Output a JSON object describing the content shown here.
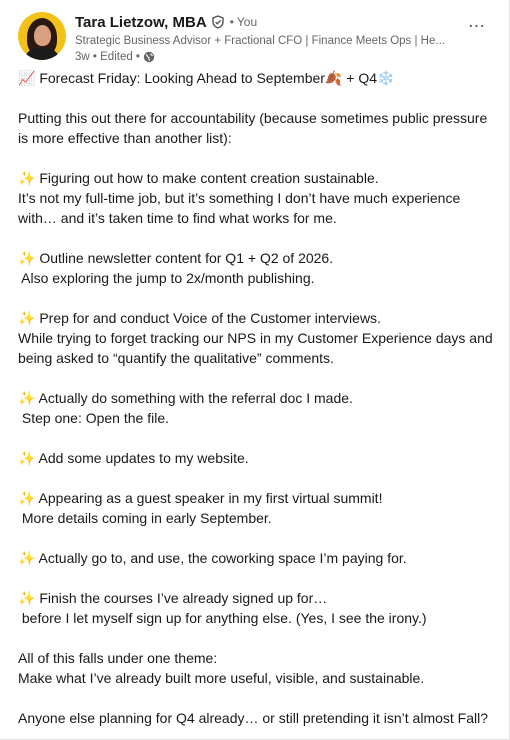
{
  "author": {
    "name": "Tara Lietzow, MBA",
    "you_label": "You",
    "headline": "Strategic Business Advisor + Fractional CFO | Finance Meets Ops | He...",
    "time": "3w",
    "edited_label": "Edited",
    "visibility_icon": "globe-icon",
    "verified_icon": "verified-shield-icon"
  },
  "menu": {
    "more_label": "…"
  },
  "post": {
    "lines": [
      "📈 Forecast Friday: Looking Ahead to September🍂 + Q4❄️",
      "",
      "Putting this out there for accountability (because sometimes public pressure",
      "is more effective than another list):",
      "",
      "✨ Figuring out how to make content creation sustainable.",
      "It’s not my full-time job, but it’s something I don’t have much experience",
      "with… and it’s taken time to find what works for me.",
      "",
      "✨ Outline newsletter content for Q1 + Q2 of 2026.",
      " Also exploring the jump to 2x/month publishing.",
      "",
      "✨ Prep for and conduct Voice of the Customer interviews.",
      "While trying to forget tracking our NPS in my Customer Experience days and",
      "being asked to “quantify the qualitative” comments.",
      "",
      "✨ Actually do something with the referral doc I made.",
      " Step one: Open the file.",
      "",
      "✨ Add some updates to my website.",
      "",
      "✨ Appearing as a guest speaker in my first virtual summit!",
      " More details coming in early September.",
      "",
      "✨ Actually go to, and use, the coworking space I’m paying for.",
      "",
      "✨ Finish the courses I’ve already signed up for…",
      " before I let myself sign up for anything else. (Yes, I see the irony.)",
      "",
      "All of this falls under one theme:",
      "Make what I’ve already built more useful, visible, and sustainable.",
      "",
      "Anyone else planning for Q4 already… or still pretending it isn’t almost Fall?"
    ]
  }
}
